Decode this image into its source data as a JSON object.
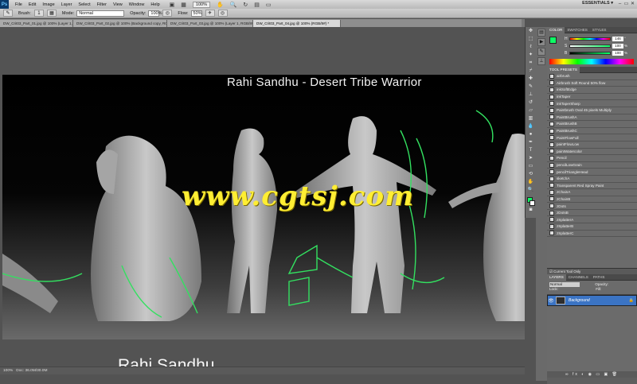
{
  "menu": {
    "logo": "Ps",
    "items": [
      "File",
      "Edit",
      "Image",
      "Layer",
      "Select",
      "Filter",
      "View",
      "Window",
      "Help"
    ],
    "zoom": "100%",
    "workspace": "ESSENTIALS ▾",
    "minimize": "–",
    "restore": "▭",
    "close": "✕"
  },
  "options": {
    "brush_label": "Brush:",
    "brush_size": "1",
    "mode_label": "Mode:",
    "mode_value": "Normal",
    "opacity_label": "Opacity:",
    "opacity_value": "100%",
    "flow_label": "Flow:",
    "flow_value": "50%"
  },
  "tabs": [
    {
      "label": "DW_Crit03_Part_01.jpg @ 100% (Layer 1, RGB/8#) *"
    },
    {
      "label": "DW_Crit03_Part_02.jpg @ 100% (Background copy, RGB/8#) *"
    },
    {
      "label": "DW_Crit03_Part_03.jpg @ 100% (Layer 1, RGB/8#) *"
    },
    {
      "label": "DW_Crit03_Part_04.jpg @ 100% (RGB/8#) *"
    }
  ],
  "canvas": {
    "title": "Rahi Sandhu - Desert Tribe Warrior",
    "watermark": "www.cgtsj.com",
    "signature": "Rahi Sandhu"
  },
  "status": {
    "zoom": "100%",
    "doc": "Doc: 36.0M/30.0M"
  },
  "color_panel": {
    "tabs": [
      "COLOR",
      "SWATCHES",
      "STYLES"
    ],
    "sliders": [
      {
        "label": "H",
        "value": "146",
        "unit": "°"
      },
      {
        "label": "S",
        "value": "100",
        "unit": "%"
      },
      {
        "label": "B",
        "value": "100",
        "unit": "%"
      }
    ],
    "accent": "#0dff65"
  },
  "presets_panel": {
    "tabs": [
      "TOOL PRESETS"
    ],
    "items": [
      "airbrush",
      "Airbrush Soft Round 50% flow",
      "inkSoftEdge",
      "inkTaper",
      "inkTaperSharp",
      "Paintbrush Oval 45 pixels Multiply",
      "PaintBrushA",
      "PaintBrushB",
      "PaintBrushC",
      "PaintFlowFull",
      "paintFlowLow",
      "paintWatercolor",
      "Pencil",
      "pencilLowGrain",
      "pencilTriangleHead",
      "sketchA",
      "Transparent Red Spray Paint",
      "zChainA",
      "zChainB",
      "zDots",
      "zDotsB",
      "zSplatterA",
      "zSplatterB",
      "zSplatterC"
    ],
    "footer": "☑ Current Tool Only"
  },
  "layers_panel": {
    "tabs": [
      "LAYERS",
      "CHANNELS",
      "PATHS"
    ],
    "blend_mode": "Normal",
    "opacity_label": "Opacity:",
    "fill_label": "Fill:",
    "lock_label": "Lock:",
    "layer_name": "Background",
    "footer": "∞ fx ◐ ◉ ▭ ▣ 🗑"
  }
}
